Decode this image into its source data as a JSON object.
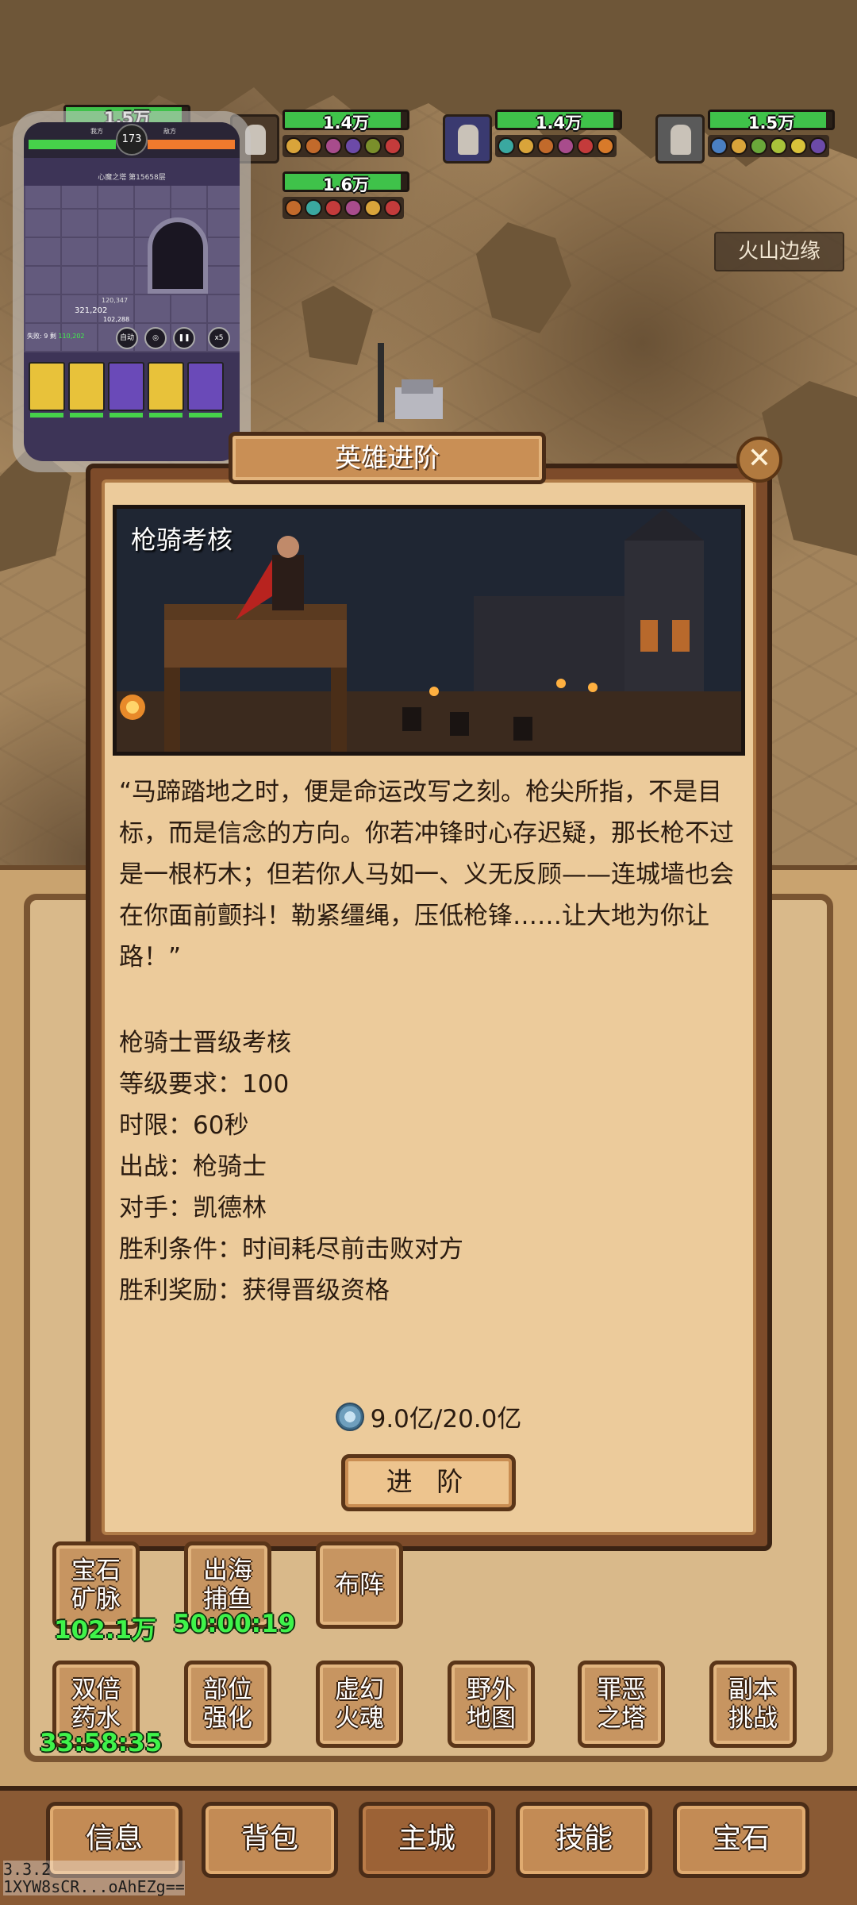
{
  "heroes": [
    {
      "hp": "1.4万",
      "hp_fill": 0.95
    },
    {
      "hp": "1.4万",
      "hp_fill": 0.95
    },
    {
      "hp": "1.5万",
      "hp_fill": 0.95
    },
    {
      "hp": "1.6万",
      "hp_fill": 0.95
    }
  ],
  "partial_hp": "1.5万",
  "region": "火山边缘",
  "mini_window": {
    "level": "173",
    "left_label": "我方",
    "right_label": "敌方",
    "stage": "心魔之塔 第15658层",
    "ctrl_auto": "自动",
    "ctrl_speed": "x5",
    "damage_top": "120,347",
    "damage_mid": "321,202",
    "damage_low": "102,288",
    "time_label": "失败: 9 剩",
    "time_val": "110,202"
  },
  "dialog": {
    "title": "英雄进阶",
    "close_glyph": "✕",
    "scene_title": "枪骑考核",
    "quote": "“马蹄踏地之时，便是命运改写之刻。枪尖所指，不是目标，而是信念的方向。你若冲锋时心存迟疑，那长枪不过是一根朽木；但若你人马如一、义无反顾——连城墙也会在你面前颤抖！勒紧缰绳，压低枪锋……让大地为你让路！”",
    "requirements": [
      "枪骑士晋级考核",
      "等级要求：100",
      "时限：60秒",
      "出战：枪骑士",
      "对手：凯德林",
      "胜利条件：时间耗尽前击败对方",
      "胜利奖励：获得晋级资格"
    ],
    "cost": "9.0亿/20.0亿",
    "advance_label": "进 阶"
  },
  "features": {
    "gem_mine": "宝石矿脉",
    "gem_mine_val": "102.1万",
    "fishing": "出海捕鱼",
    "fishing_timer": "50:00:19",
    "formation": "布阵",
    "double_potion": "双倍药水",
    "double_potion_timer": "33:58:35",
    "part_enhance": "部位强化",
    "phantom_soul": "虚幻火魂",
    "wild_map": "野外地图",
    "evil_tower": "罪恶之塔",
    "dungeon": "副本挑战"
  },
  "tabs": [
    "信息",
    "背包",
    "主城",
    "技能",
    "宝石"
  ],
  "active_tab": "主城",
  "version": "3.3.2",
  "build_id": "1XYW8sCR...oAhEZg=="
}
